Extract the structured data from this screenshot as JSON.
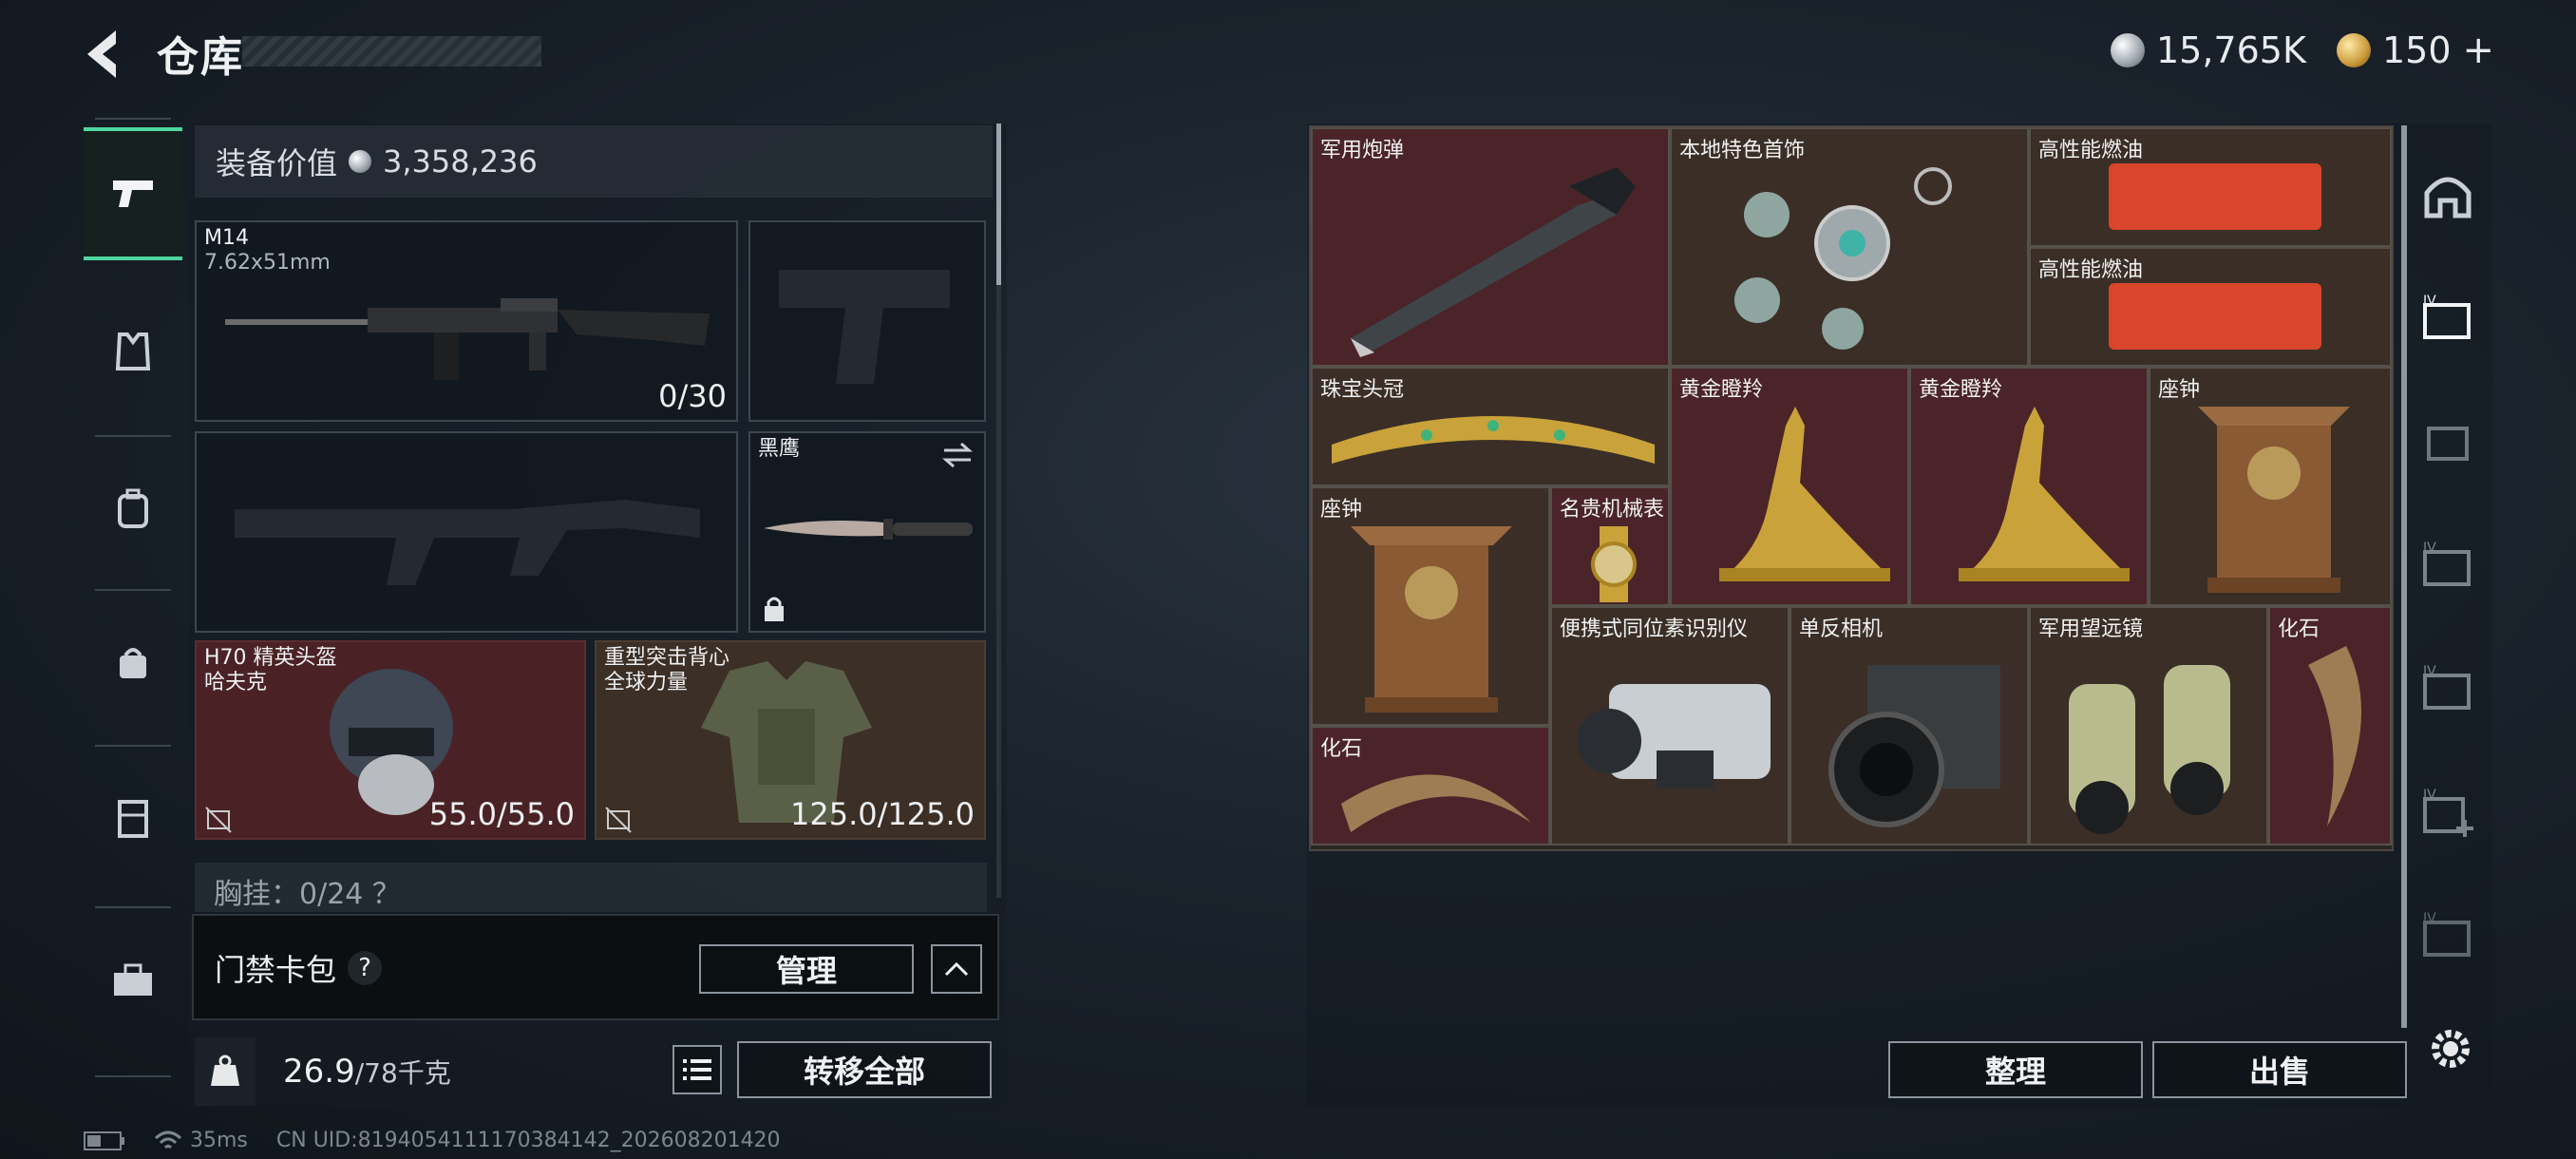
{
  "header": {
    "title": "仓库",
    "silver_amount": "15,765K",
    "gold_amount": "150"
  },
  "equipment": {
    "value_label": "装备价值",
    "value": "3,358,236",
    "primary": {
      "name": "M14",
      "caliber": "7.62x51mm",
      "ammo": "0/30"
    },
    "melee": {
      "name": "黑鹰"
    },
    "helmet": {
      "name": "H70 精英头盔",
      "sub": "哈夫克",
      "durability": "55.0/55.0"
    },
    "armor": {
      "name": "重型突击背心",
      "sub": "全球力量",
      "durability": "125.0/125.0"
    },
    "chest_rig_partial": "胸挂：0/24 ？"
  },
  "keycard": {
    "label": "门禁卡包",
    "help": "?",
    "manage_label": "管理"
  },
  "footer": {
    "weight_current": "26.9",
    "weight_max": "/78千克",
    "transfer_all_label": "转移全部"
  },
  "stash_items": [
    {
      "label": "军用炮弹",
      "tone": "red"
    },
    {
      "label": "本地特色首饰",
      "tone": "brown"
    },
    {
      "label": "高性能燃油",
      "tone": "brown"
    },
    {
      "label": "高性能燃油",
      "tone": "brown"
    },
    {
      "label": "珠宝头冠",
      "tone": "brown"
    },
    {
      "label": "黄金瞪羚",
      "tone": "red"
    },
    {
      "label": "黄金瞪羚",
      "tone": "red"
    },
    {
      "label": "座钟",
      "tone": "brown"
    },
    {
      "label": "座钟",
      "tone": "brown"
    },
    {
      "label": "名贵机械表",
      "tone": "red"
    },
    {
      "label": "便携式同位素识别仪",
      "tone": "brown"
    },
    {
      "label": "单反相机",
      "tone": "brown"
    },
    {
      "label": "军用望远镜",
      "tone": "brown"
    },
    {
      "label": "化石",
      "tone": "red"
    },
    {
      "label": "化石",
      "tone": "red"
    }
  ],
  "actions": {
    "sort_label": "整理",
    "sell_label": "出售"
  },
  "status": {
    "ping": "35ms",
    "uid": "CN UID:8194054111170384142_202608201420"
  },
  "colors": {
    "accent": "#4fd6a0",
    "red_rarity": "#4a2428",
    "brown_rarity": "#3a2e27"
  }
}
